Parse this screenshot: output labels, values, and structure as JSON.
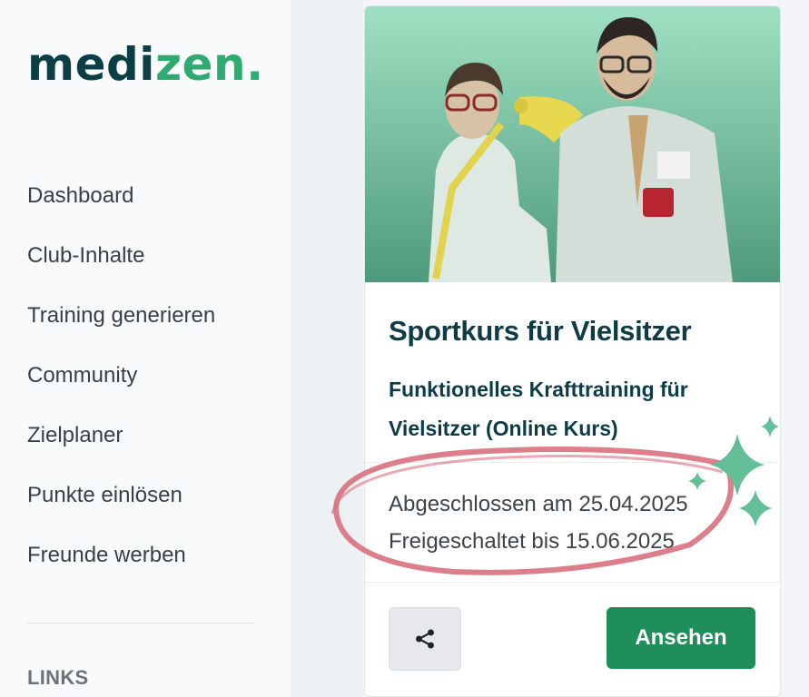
{
  "brand": {
    "part1": "medi",
    "part2": "zen",
    "part3": "."
  },
  "sidebar": {
    "items": [
      {
        "label": "Dashboard"
      },
      {
        "label": "Club-Inhalte"
      },
      {
        "label": "Training generieren"
      },
      {
        "label": "Community"
      },
      {
        "label": "Zielplaner"
      },
      {
        "label": "Punkte einlösen"
      },
      {
        "label": "Freunde werben"
      }
    ],
    "section_label": "LINKS"
  },
  "course": {
    "title": "Sportkurs für Vielsitzer",
    "subtitle": "Funktionelles Krafttraining für Vielsitzer (Online Kurs)",
    "completed": "Abgeschlossen am 25.04.2025",
    "unlocked_until": "Freigeschaltet bis 15.06.2025",
    "share_icon": "share-icon",
    "view_label": "Ansehen"
  },
  "colors": {
    "brand_dark": "#0b3f45",
    "brand_green": "#2faa70",
    "button_green": "#1e8f5a",
    "annotation_red": "#d9707e",
    "sparkle_green": "#63bf97"
  }
}
